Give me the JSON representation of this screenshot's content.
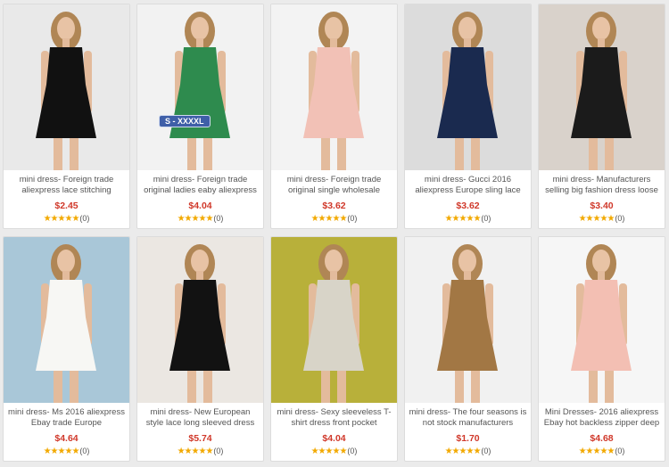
{
  "products": [
    {
      "title": "mini dress- Foreign trade aliexpress lace stitching",
      "price": "$2.45",
      "stars": "★★★★★",
      "reviews": "(0)",
      "image_icon": "black-lace-dress-photo",
      "bg": "#e9e9e9",
      "dress": "#111111"
    },
    {
      "title": "mini dress- Foreign trade original ladies eaby aliexpress",
      "price": "$4.04",
      "stars": "★★★★★",
      "reviews": "(0)",
      "image_icon": "green-lace-dress-photo",
      "bg": "#f2f2f2",
      "dress": "#2e8b4e",
      "badge": "S - XXXXL"
    },
    {
      "title": "mini dress- Foreign trade original single wholesale",
      "price": "$3.62",
      "stars": "★★★★★",
      "reviews": "(0)",
      "image_icon": "pink-shift-dress-photo",
      "bg": "#f3f3f3",
      "dress": "#f2c1b6"
    },
    {
      "title": "mini dress- Gucci 2016 aliexpress Europe sling lace",
      "price": "$3.62",
      "stars": "★★★★★",
      "reviews": "(0)",
      "image_icon": "navy-lace-dress-photo",
      "bg": "#dcdcdc",
      "dress": "#1a2a4f"
    },
    {
      "title": "mini dress- Manufacturers selling big fashion dress loose",
      "price": "$3.40",
      "stars": "★★★★★",
      "reviews": "(0)",
      "image_icon": "chevron-print-dress-photo",
      "bg": "#d9d2cb",
      "dress": "#1b1b1b"
    },
    {
      "title": "mini dress- Ms 2016 aliexpress Ebay trade Europe",
      "price": "$4.64",
      "stars": "★★★★★",
      "reviews": "(0)",
      "image_icon": "white-lace-dress-photo",
      "bg": "#a9c7d8",
      "dress": "#f7f7f4"
    },
    {
      "title": "mini dress- New European style lace long sleeved dress",
      "price": "$5.74",
      "stars": "★★★★★",
      "reviews": "(0)",
      "image_icon": "black-white-bow-dress-photo",
      "bg": "#ebe7e2",
      "dress": "#121212"
    },
    {
      "title": "mini dress- Sexy sleeveless T-shirt dress front pocket",
      "price": "$4.04",
      "stars": "★★★★★",
      "reviews": "(0)",
      "image_icon": "tank-skirt-dress-photo",
      "bg": "#b8b03a",
      "dress": "#d8d4c8"
    },
    {
      "title": "mini dress- The four seasons is not stock manufacturers",
      "price": "$1.70",
      "stars": "★★★★★",
      "reviews": "(0)",
      "image_icon": "leopard-print-dress-photo",
      "bg": "#f1f1f1",
      "dress": "#a27744"
    },
    {
      "title": "Mini Dresses- 2016 aliexpress Ebay hot backless zipper deep",
      "price": "$4.68",
      "stars": "★★★★★",
      "reviews": "(0)",
      "image_icon": "pink-skater-dress-photo",
      "bg": "#f6f6f6",
      "dress": "#f3bfb3"
    }
  ]
}
